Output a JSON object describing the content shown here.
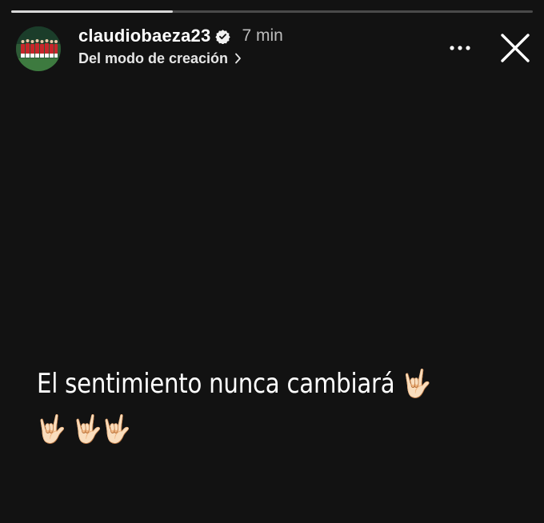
{
  "story": {
    "progress": 0.31,
    "username": "claudiobaeza23",
    "verified": true,
    "time": "7 min",
    "subtitle": "Del modo de creación",
    "caption": "El sentimiento nunca cambiará 🤟🏻🤟🏻 🤟🏻🤟🏻"
  },
  "icons": {
    "verified": "verified-badge-icon",
    "subtitle_chevron": "chevron-right-icon",
    "more": "more-options-icon",
    "close": "close-icon"
  },
  "colors": {
    "background": "#121212",
    "progress_fill": "#d8d8d8",
    "progress_track": "#4a4a4a",
    "text": "#ffffff",
    "secondary_text": "#bdbdbd"
  }
}
